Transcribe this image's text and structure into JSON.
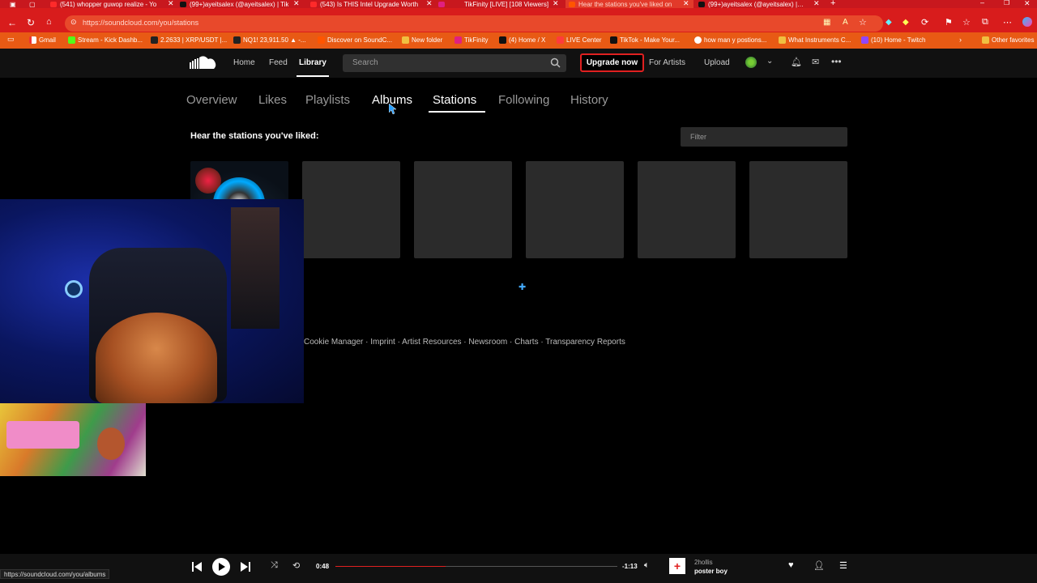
{
  "browser": {
    "tabs": [
      {
        "title": "(541) whopper guwop realize - Yo",
        "icon_color": "#ff2a2a"
      },
      {
        "title": "(99+)ayeitsalex (@ayeitsalex) | Tik",
        "icon_color": "#111111"
      },
      {
        "title": "(543) Is THIS Intel Upgrade Worth",
        "icon_color": "#ff2a2a"
      },
      {
        "title": "TikFinity [LIVE] [108 Viewers]",
        "icon_color": "#e02080"
      },
      {
        "title": "Hear the stations you've liked on",
        "icon_color": "#ff5500",
        "active": true
      },
      {
        "title": "(99+)ayeitsalex (@ayeitsalex) | Tik",
        "icon_color": "#111111"
      }
    ],
    "url": "https://soundcloud.com/you/stations",
    "bookmarks": [
      {
        "label": "Gmail",
        "icon_color": "#ffffff"
      },
      {
        "label": "Stream - Kick Dashb...",
        "icon_color": "#53fc18"
      },
      {
        "label": "2.2633 | XRP/USDT |...",
        "icon_color": "#222222"
      },
      {
        "label": "NQ1! 23,911.50 ▲ -...",
        "icon_color": "#222222"
      },
      {
        "label": "Discover on SoundC...",
        "icon_color": "#ff5500"
      },
      {
        "label": "New folder",
        "icon_color": "#f0c040"
      },
      {
        "label": "TikFinity",
        "icon_color": "#e02080"
      },
      {
        "label": "(4) Home / X",
        "icon_color": "#111111"
      },
      {
        "label": "LIVE Center",
        "icon_color": "#ff3b3b"
      },
      {
        "label": "TikTok - Make Your...",
        "icon_color": "#111111"
      },
      {
        "label": "how man y postions...",
        "icon_color": "#ffffff"
      },
      {
        "label": "What Instruments C...",
        "icon_color": "#f0c040"
      },
      {
        "label": "(10) Home - Twitch",
        "icon_color": "#9146ff"
      }
    ],
    "other_favorites": "Other favorites"
  },
  "header": {
    "nav": {
      "home": "Home",
      "feed": "Feed",
      "library": "Library"
    },
    "search_placeholder": "Search",
    "upgrade": "Upgrade now",
    "for_artists": "For Artists",
    "upload": "Upload"
  },
  "library_tabs": {
    "overview": "Overview",
    "likes": "Likes",
    "playlists": "Playlists",
    "albums": "Albums",
    "stations": "Stations",
    "following": "Following",
    "history": "History"
  },
  "main": {
    "heading": "Hear the stations you've liked:",
    "filter_placeholder": "Filter"
  },
  "footer": {
    "links": [
      "Cookie Manager",
      "Imprint",
      "Artist Resources",
      "Newsroom",
      "Charts",
      "Transparency Reports"
    ],
    "separator": " · "
  },
  "player": {
    "elapsed": "0:48",
    "remaining": "-1:13",
    "progress": 0.39,
    "artist": "2hollis",
    "track": "poster boy"
  },
  "status_url": "https://soundcloud.com/you/albums",
  "colors": {
    "accent": "#e02020",
    "soundcloud_orange": "#ff5500"
  }
}
